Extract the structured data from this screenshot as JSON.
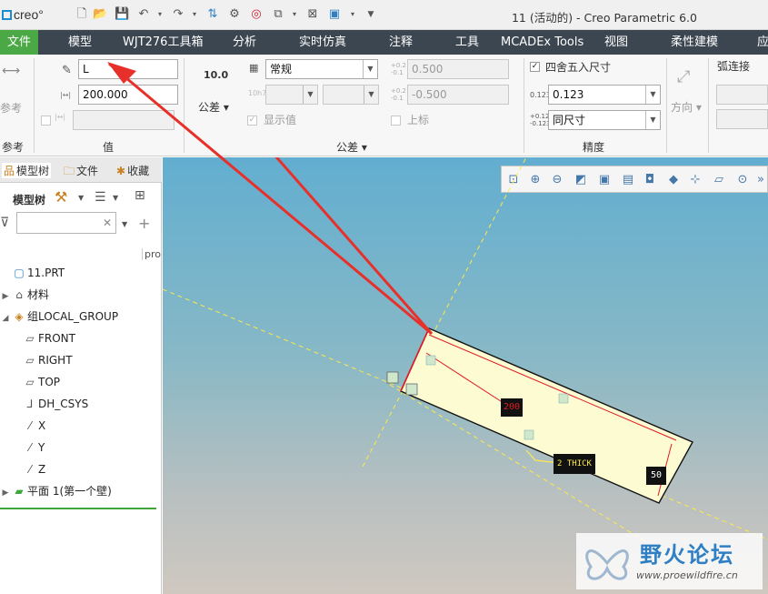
{
  "app": {
    "logo": "creo",
    "window_title": "11 (活动的) - Creo Parametric 6.0"
  },
  "menu": [
    "文件",
    "模型",
    "WJT276工具箱",
    "分析",
    "实时仿真",
    "注释",
    "工具",
    "MCADEx Tools",
    "视图",
    "柔性建模",
    "应"
  ],
  "ribbon": {
    "reference": {
      "label": "参考",
      "group": "参考"
    },
    "value": {
      "name_field": "L",
      "value_field": "200.000",
      "group": "值"
    },
    "tolerance": {
      "format_icon": "10.0",
      "format_label": "公差",
      "standard_select": "常规",
      "show_value": "显示值",
      "upper": "0.500",
      "lower": "-0.500",
      "upper_label": "上标",
      "group": "公差"
    },
    "precision": {
      "rounded": "四舍五入尺寸",
      "decimals": "0.123",
      "same_size": "同尺寸",
      "group": "精度"
    },
    "arc": {
      "arc_connect": "弧连接",
      "direction": "方向"
    }
  },
  "panel": {
    "tabs": [
      "模型树",
      "文件",
      "收藏"
    ],
    "toolbar_label": "模型树",
    "column_header": "pro",
    "tree": [
      {
        "label": "11.PRT",
        "icon": "part-icon",
        "expand": ""
      },
      {
        "label": "材料",
        "icon": "material-icon",
        "expand": "▶"
      },
      {
        "label": "组LOCAL_GROUP",
        "icon": "group-icon",
        "expand": "◢"
      },
      {
        "label": "FRONT",
        "icon": "plane-icon",
        "expand": ""
      },
      {
        "label": "RIGHT",
        "icon": "plane-icon",
        "expand": ""
      },
      {
        "label": "TOP",
        "icon": "plane-icon",
        "expand": ""
      },
      {
        "label": "DH_CSYS",
        "icon": "csys-icon",
        "expand": ""
      },
      {
        "label": "X",
        "icon": "axis-icon",
        "expand": ""
      },
      {
        "label": "Y",
        "icon": "axis-icon",
        "expand": ""
      },
      {
        "label": "Z",
        "icon": "axis-icon",
        "expand": ""
      },
      {
        "label": "平面 1(第一个壁)",
        "icon": "wall-icon",
        "expand": "▶"
      }
    ]
  },
  "viewport": {
    "dim_length": "200",
    "dim_thick": "2 THICK",
    "dim_width": "50"
  },
  "watermark": {
    "title": "野火论坛",
    "url": "www.proewildfire.cn"
  }
}
